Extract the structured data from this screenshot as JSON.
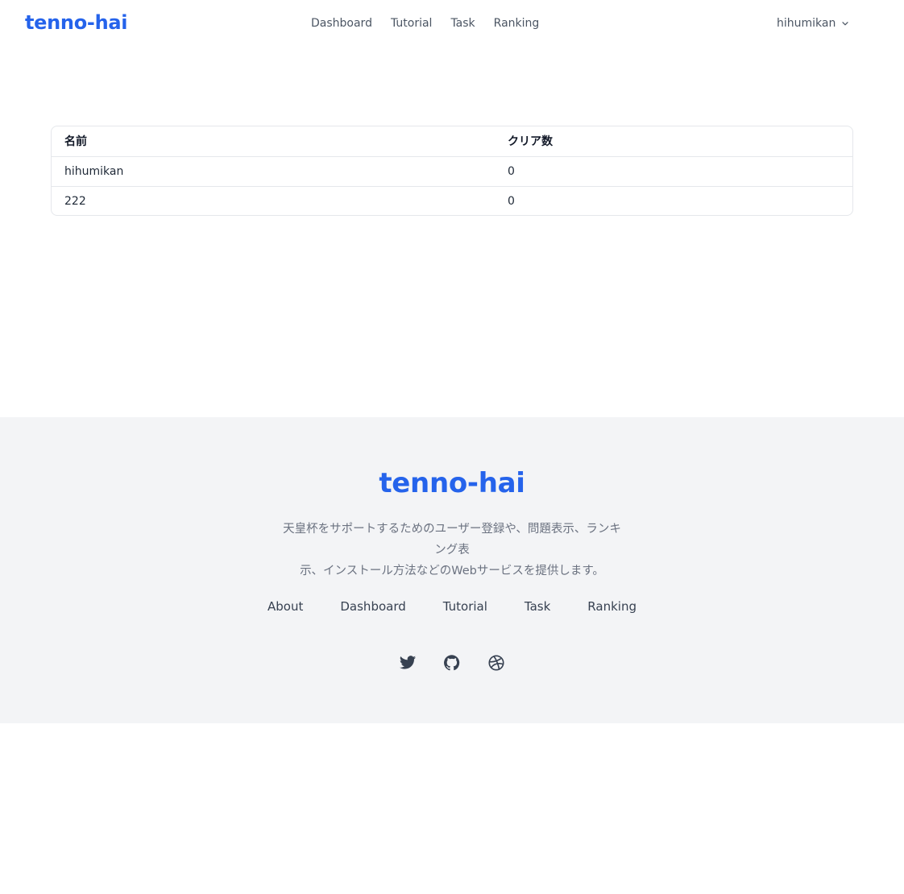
{
  "header": {
    "brand": "tenno-hai",
    "nav": [
      "Dashboard",
      "Tutorial",
      "Task",
      "Ranking"
    ],
    "user": "hihumikan"
  },
  "ranking_table": {
    "columns": [
      "名前",
      "クリア数"
    ],
    "rows": [
      [
        "hihumikan",
        "0"
      ],
      [
        "222",
        "0"
      ]
    ]
  },
  "footer": {
    "brand": "tenno-hai",
    "description_line1": "天皇杯をサポートするためのユーザー登録や、問題表示、ランキング表",
    "description_line2": "示、インストール方法などのWebサービスを提供します。",
    "links": [
      "About",
      "Dashboard",
      "Tutorial",
      "Task",
      "Ranking"
    ],
    "social_icons": [
      "twitter-icon",
      "github-icon",
      "dribbble-icon"
    ]
  },
  "colors": {
    "brand": "#2563eb",
    "footer_bg": "#f3f4f6",
    "text_muted": "#6b7280"
  }
}
